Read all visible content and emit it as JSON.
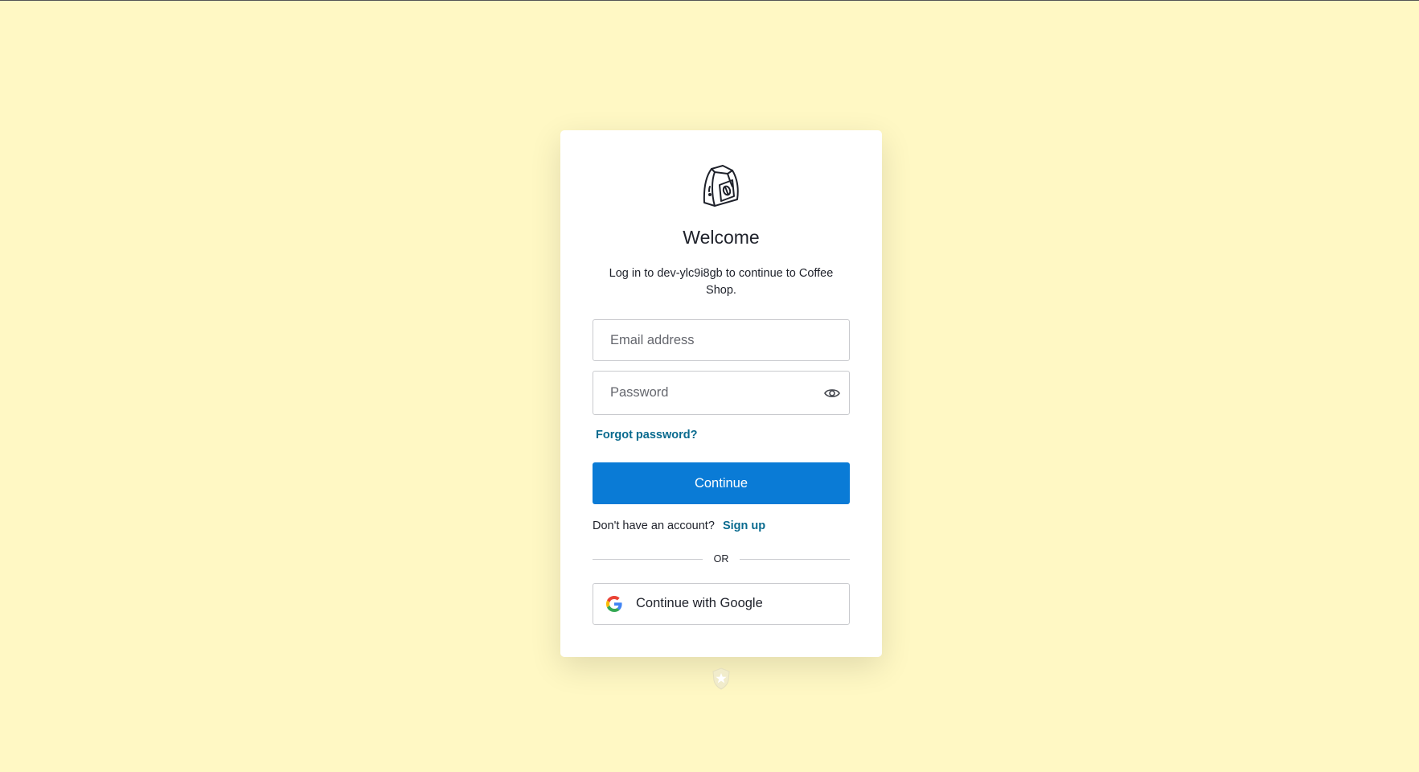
{
  "colors": {
    "background": "#fff8c4",
    "primary_button": "#0a7bd6",
    "link": "#0a6b8f"
  },
  "header": {
    "logo_icon": "coffee-bag-icon",
    "title": "Welcome",
    "subtitle": "Log in to dev-ylc9i8gb to continue to Coffee Shop."
  },
  "form": {
    "email": {
      "placeholder": "Email address",
      "value": ""
    },
    "password": {
      "placeholder": "Password",
      "value": "",
      "toggle_icon": "eye-icon"
    },
    "forgot_label": "Forgot password?",
    "continue_label": "Continue"
  },
  "signup": {
    "prompt": "Don't have an account?",
    "link_label": "Sign up"
  },
  "divider": {
    "label": "OR"
  },
  "social": {
    "google_label": "Continue with Google",
    "google_icon": "google-icon"
  },
  "footer": {
    "badge_icon": "auth0-shield-icon"
  }
}
